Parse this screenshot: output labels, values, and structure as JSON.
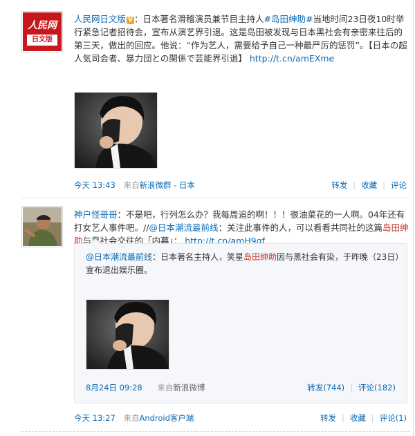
{
  "posts": [
    {
      "author": "人民网日文版",
      "verified_badge": "V",
      "text_before_hashtag": "：日本著名滑稽演员兼节目主持人",
      "hashtag": "#岛田绅助#",
      "text_after_hashtag": "当地时间23日夜10时举行紧急记者招待会，宣布从演艺界引退。这是岛田被发现与日本黑社会有亲密来往后的第三天，做出的回应。他说：“作为艺人，需要给予自己一种最严厉的惩罚”。【日本の超人気司会者、暴力団との関係で芸能界引退】",
      "link": "http://t.cn/amEXme",
      "time": "今天 13:43",
      "source_prefix": "来自",
      "source": "新浪微群 - 日本",
      "action_forward": "转发",
      "action_favorite": "收藏",
      "action_comment": "评论",
      "avatar_text_top": "人民网",
      "avatar_text_bottom": "日文版"
    },
    {
      "author": "神户怪哥哥",
      "text_1": "：不是吧，行列怎么办？我每周追的啊！！！很油菜花的一人啊。04年还有打女艺人事件吧。//",
      "mention": "@日本潮流最前线",
      "text_2": "：关注此事件的人，可以看看共同社的这篇",
      "hl_name": "岛田绅助",
      "text_3": "与黑社会交往的「内幕」：",
      "link": "http://t.cn/amH9gf",
      "time": "今天 13:27",
      "source_prefix": "来自",
      "source": "Android客户端",
      "action_forward": "转发",
      "action_favorite": "收藏",
      "action_comment": "评论(1)",
      "quoted": {
        "author": "@日本潮流最前线",
        "text_1": "：日本著名主持人，笑星",
        "hl_name": "岛田绅助",
        "text_2": "因与黑社会有染，于昨晚（23日）宣布退出娱乐圈。",
        "time": "8月24日 09:28",
        "source_prefix": "来自",
        "source": "新浪微博",
        "action_forward": "转发(744)",
        "action_comment": "评论(182)"
      }
    }
  ],
  "colors": {
    "link": "#0a6ab4",
    "highlight": "#c0392b",
    "meta": "#999999",
    "logo_red": "#c8161d"
  }
}
